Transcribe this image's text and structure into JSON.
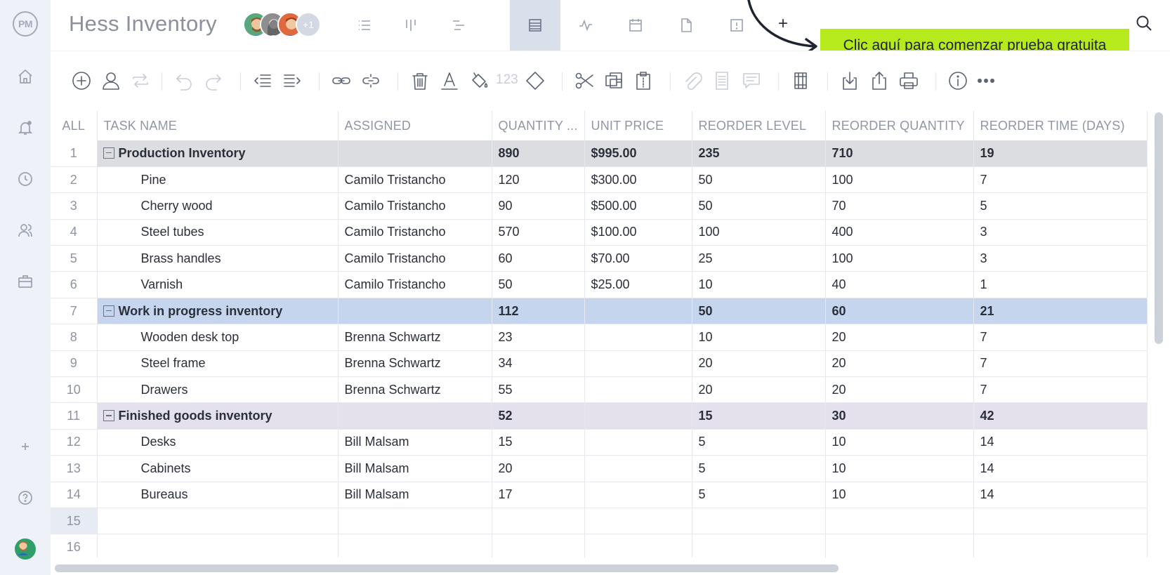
{
  "app": {
    "logo_text": "PM",
    "project_title": "Hess Inventory",
    "extra_members": "+1",
    "add_view_label": "+",
    "cta_label": "Clic aquí para comenzar prueba gratuita",
    "cta_color": "#b7ea1d"
  },
  "sidebar": {
    "items": [
      {
        "icon": "home-icon"
      },
      {
        "icon": "notifications-icon"
      },
      {
        "icon": "clock-icon"
      },
      {
        "icon": "team-icon"
      },
      {
        "icon": "briefcase-icon"
      },
      {
        "icon": "add-icon",
        "label": "+"
      },
      {
        "icon": "help-icon"
      },
      {
        "icon": "user-avatar"
      }
    ]
  },
  "views": [
    {
      "icon": "list-view-icon",
      "active": false
    },
    {
      "icon": "board-view-icon",
      "active": false
    },
    {
      "icon": "gantt-view-icon",
      "active": false
    },
    {
      "icon": "sheet-view-icon",
      "active": true
    },
    {
      "icon": "dashboard-view-icon",
      "active": false
    },
    {
      "icon": "calendar-view-icon",
      "active": false
    },
    {
      "icon": "document-view-icon",
      "active": false
    },
    {
      "icon": "risk-view-icon",
      "active": false
    }
  ],
  "toolbar": {
    "number_format_label": "123"
  },
  "grid": {
    "columns": [
      "ALL",
      "TASK NAME",
      "ASSIGNED",
      "QUANTITY ...",
      "UNIT PRICE",
      "REORDER LEVEL",
      "REORDER QUANTITY",
      "REORDER TIME (DAYS)"
    ],
    "rows": [
      {
        "n": "1",
        "type": "group",
        "style": "g1",
        "task": "Production Inventory",
        "assigned": "",
        "qty": "890",
        "price": "$995.00",
        "level": "235",
        "rqty": "710",
        "rtime": "19"
      },
      {
        "n": "2",
        "type": "child",
        "task": "Pine",
        "assigned": "Camilo Tristancho",
        "qty": "120",
        "price": "$300.00",
        "level": "50",
        "rqty": "100",
        "rtime": "7"
      },
      {
        "n": "3",
        "type": "child",
        "task": "Cherry wood",
        "assigned": "Camilo Tristancho",
        "qty": "90",
        "price": "$500.00",
        "level": "50",
        "rqty": "70",
        "rtime": "5"
      },
      {
        "n": "4",
        "type": "child",
        "task": "Steel tubes",
        "assigned": "Camilo Tristancho",
        "qty": "570",
        "price": "$100.00",
        "level": "100",
        "rqty": "400",
        "rtime": "3"
      },
      {
        "n": "5",
        "type": "child",
        "task": "Brass handles",
        "assigned": "Camilo Tristancho",
        "qty": "60",
        "price": "$70.00",
        "level": "25",
        "rqty": "100",
        "rtime": "3"
      },
      {
        "n": "6",
        "type": "child",
        "task": "Varnish",
        "assigned": "Camilo Tristancho",
        "qty": "50",
        "price": "$25.00",
        "level": "10",
        "rqty": "40",
        "rtime": "1"
      },
      {
        "n": "7",
        "type": "group",
        "style": "g2",
        "task": "Work in progress inventory",
        "assigned": "",
        "qty": "112",
        "price": "",
        "level": "50",
        "rqty": "60",
        "rtime": "21"
      },
      {
        "n": "8",
        "type": "child",
        "task": "Wooden desk top",
        "assigned": "Brenna Schwartz",
        "qty": "23",
        "price": "",
        "level": "10",
        "rqty": "20",
        "rtime": "7"
      },
      {
        "n": "9",
        "type": "child",
        "task": "Steel frame",
        "assigned": "Brenna Schwartz",
        "qty": "34",
        "price": "",
        "level": "20",
        "rqty": "20",
        "rtime": "7"
      },
      {
        "n": "10",
        "type": "child",
        "task": "Drawers",
        "assigned": "Brenna Schwartz",
        "qty": "55",
        "price": "",
        "level": "20",
        "rqty": "20",
        "rtime": "7"
      },
      {
        "n": "11",
        "type": "group",
        "style": "g3",
        "task": "Finished goods inventory",
        "assigned": "",
        "qty": "52",
        "price": "",
        "level": "15",
        "rqty": "30",
        "rtime": "42"
      },
      {
        "n": "12",
        "type": "child",
        "task": "Desks",
        "assigned": "Bill Malsam",
        "qty": "15",
        "price": "",
        "level": "5",
        "rqty": "10",
        "rtime": "14"
      },
      {
        "n": "13",
        "type": "child",
        "task": "Cabinets",
        "assigned": "Bill Malsam",
        "qty": "20",
        "price": "",
        "level": "5",
        "rqty": "10",
        "rtime": "14"
      },
      {
        "n": "14",
        "type": "child",
        "task": "Bureaus",
        "assigned": "Bill Malsam",
        "qty": "17",
        "price": "",
        "level": "5",
        "rqty": "10",
        "rtime": "14"
      },
      {
        "n": "15",
        "type": "empty",
        "task": "",
        "assigned": "",
        "qty": "",
        "price": "",
        "level": "",
        "rqty": "",
        "rtime": ""
      },
      {
        "n": "16",
        "type": "empty",
        "task": "",
        "assigned": "",
        "qty": "",
        "price": "",
        "level": "",
        "rqty": "",
        "rtime": ""
      }
    ]
  }
}
